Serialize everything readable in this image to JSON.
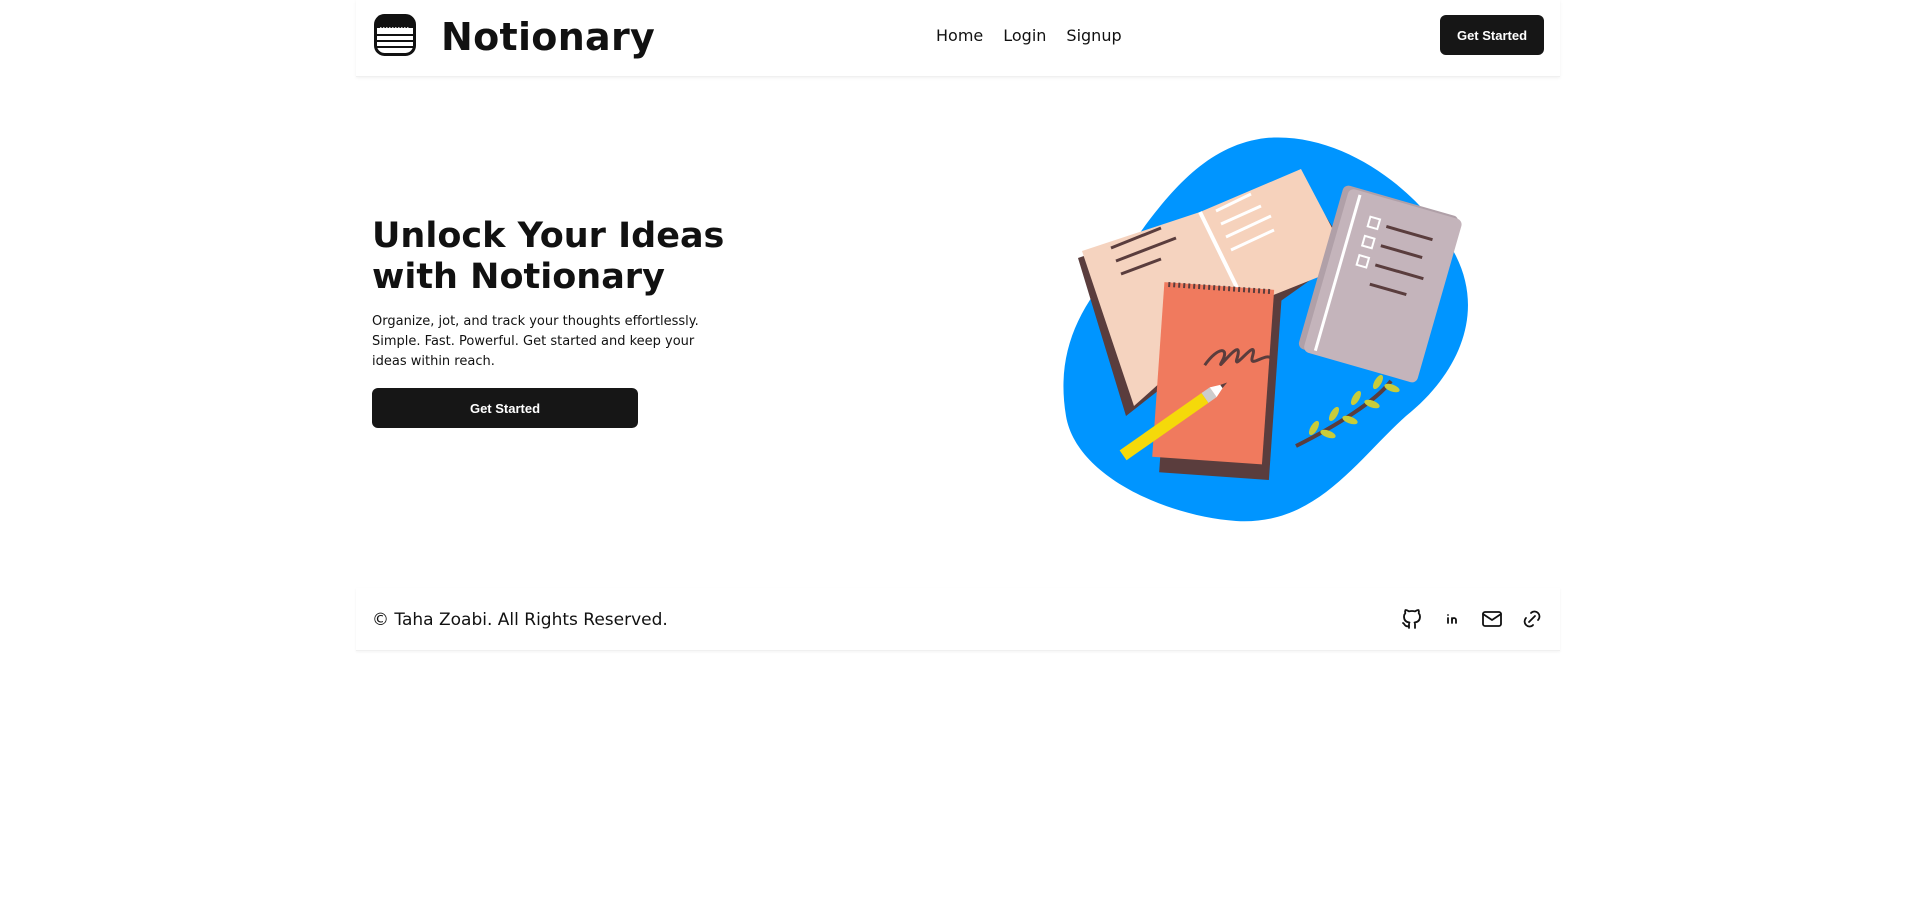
{
  "header": {
    "brand": "Notionary",
    "logo_icon": "notebook-icon",
    "nav": [
      {
        "label": "Home"
      },
      {
        "label": "Login"
      },
      {
        "label": "Signup"
      }
    ],
    "cta_label": "Get Started"
  },
  "hero": {
    "title": "Unlock Your Ideas with Notionary",
    "description": "Organize, jot, and track your thoughts effortlessly. Simple. Fast. Powerful. Get started and keep your ideas within reach.",
    "cta_label": "Get Started",
    "illustration": "notebooks-illustration"
  },
  "footer": {
    "copyright": "© Taha Zoabi. All Rights Reserved.",
    "social_icons": [
      "github-icon",
      "linkedin-icon",
      "mail-icon",
      "link-icon"
    ]
  },
  "colors": {
    "button_bg": "#161616",
    "button_text": "#ffffff",
    "blob_blue": "#0095ff",
    "book_peach": "#f5d3bf",
    "notepad_orange": "#f07a5e",
    "card_mauve": "#c4b4bb",
    "pencil_yellow": "#f5d90a"
  }
}
